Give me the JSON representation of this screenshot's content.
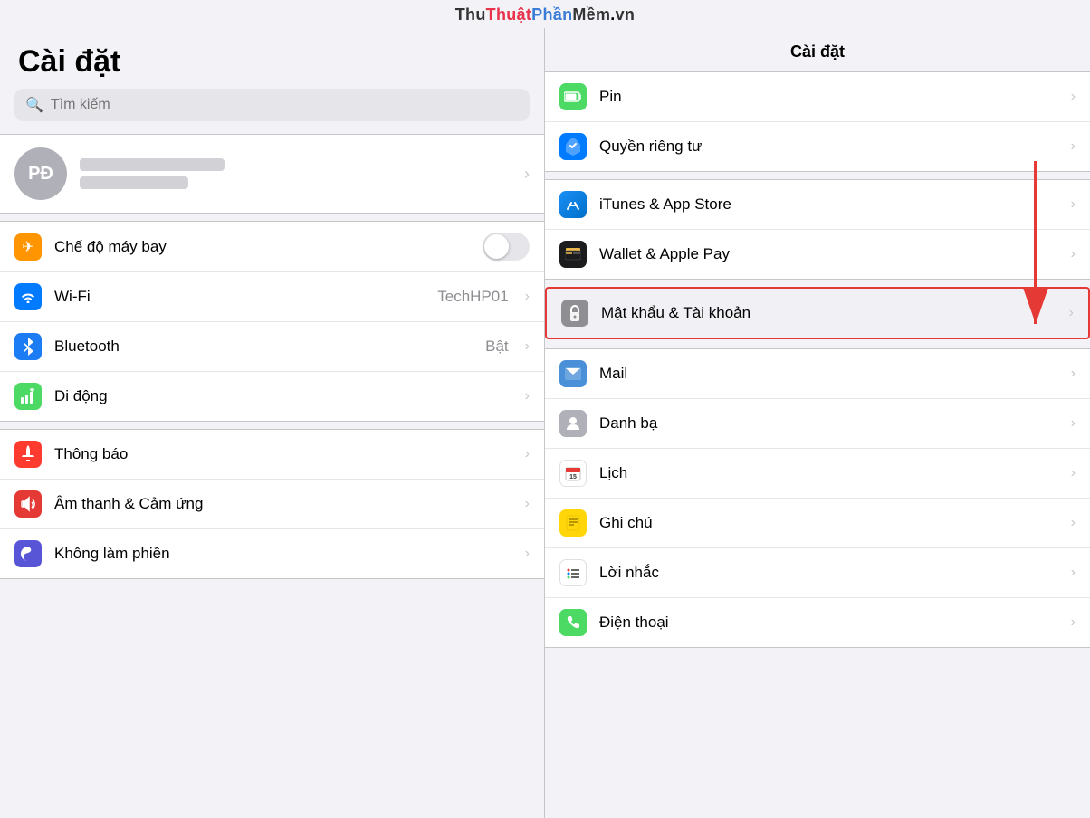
{
  "watermark": {
    "thu": "Thu",
    "thuat": "Thuật",
    "phan": "Phần",
    "mem": "Mềm",
    "dot": ".",
    "vn": "vn"
  },
  "left": {
    "title": "Cài đặt",
    "search_placeholder": "Tìm kiếm",
    "profile": {
      "initials": "PĐ"
    },
    "group1": [
      {
        "label": "Chế độ máy bay",
        "icon_color": "orange",
        "icon_symbol": "✈",
        "has_toggle": true
      },
      {
        "label": "Wi-Fi",
        "icon_color": "blue",
        "icon_symbol": "📶",
        "value": "TechHP01",
        "has_chevron": true
      },
      {
        "label": "Bluetooth",
        "icon_color": "bluetooth",
        "icon_symbol": "✦",
        "value": "Bật",
        "has_chevron": true
      },
      {
        "label": "Di động",
        "icon_color": "green-cellular",
        "icon_symbol": "((·))",
        "has_chevron": true
      }
    ],
    "group2": [
      {
        "label": "Thông báo",
        "icon_color": "red",
        "icon_symbol": "🔔",
        "has_chevron": true
      },
      {
        "label": "Âm thanh & Cảm ứng",
        "icon_color": "red-sound",
        "icon_symbol": "🔊",
        "has_chevron": true
      },
      {
        "label": "Không làm phiền",
        "icon_color": "purple",
        "icon_symbol": "🌙",
        "has_chevron": true
      }
    ]
  },
  "right": {
    "header": "Cài đặt",
    "group1": [
      {
        "label": "Pin",
        "icon_type": "green",
        "icon_symbol": "🔋"
      },
      {
        "label": "Quyền riêng tư",
        "icon_type": "blue",
        "icon_symbol": "✋"
      }
    ],
    "group2": [
      {
        "label": "iTunes & App Store",
        "icon_type": "appstore",
        "icon_symbol": "A"
      },
      {
        "label": "Wallet & Apple Pay",
        "icon_type": "wallet",
        "icon_symbol": "▤"
      }
    ],
    "highlighted": {
      "label": "Mật khẩu & Tài khoản",
      "icon_type": "gray",
      "icon_symbol": "🔑"
    },
    "group3": [
      {
        "label": "Mail",
        "icon_type": "mail",
        "icon_symbol": "✉"
      },
      {
        "label": "Danh bạ",
        "icon_type": "contacts",
        "icon_symbol": "👤"
      },
      {
        "label": "Lịch",
        "icon_type": "calendar",
        "icon_symbol": "📅"
      },
      {
        "label": "Ghi chú",
        "icon_type": "notes",
        "icon_symbol": "📝"
      },
      {
        "label": "Lời nhắc",
        "icon_type": "reminders",
        "icon_symbol": "☑"
      },
      {
        "label": "Điện thoại",
        "icon_type": "phone",
        "icon_symbol": "📞"
      }
    ]
  }
}
